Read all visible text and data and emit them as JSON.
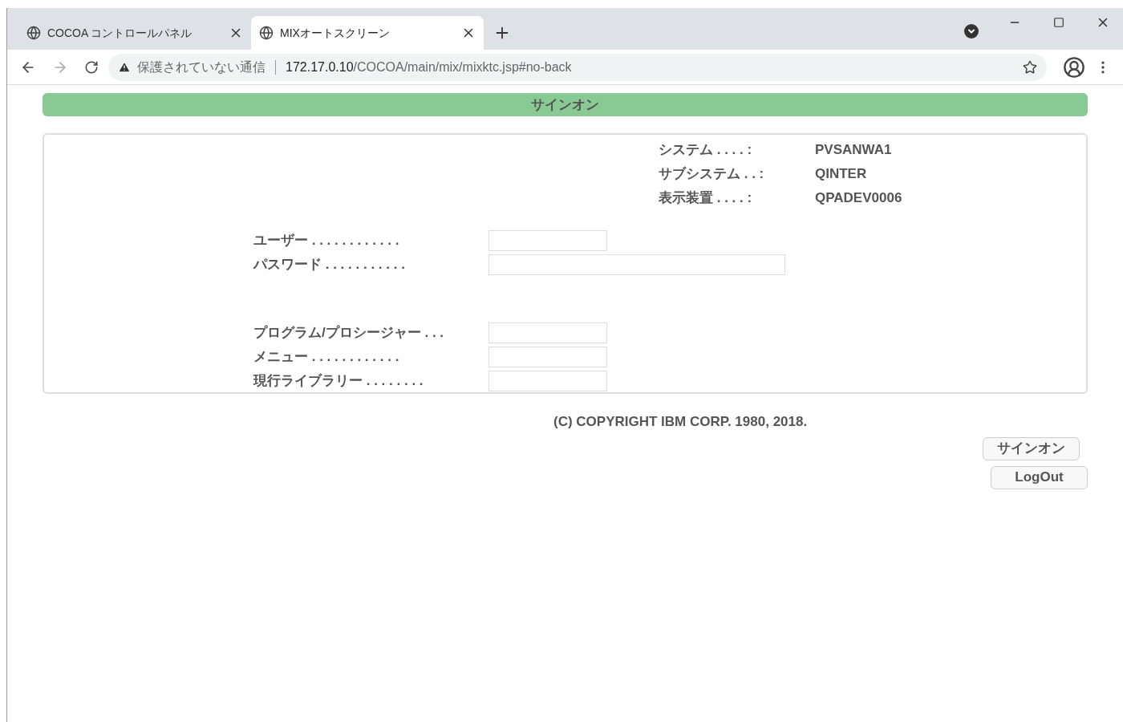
{
  "browser": {
    "tabs": [
      {
        "title": "COCOA コントロールパネル",
        "selected": false
      },
      {
        "title": "MIXオートスクリーン",
        "selected": true
      }
    ],
    "address_bar": {
      "security": "保護されていない通信",
      "host": "172.17.0.10",
      "path": "/COCOA/main/mix/mixktc.jsp#no-back"
    }
  },
  "page": {
    "title": "サインオン",
    "system_info": [
      {
        "label": "システム . . . . :",
        "value": "PVSANWA1"
      },
      {
        "label": "サブシステム . . :",
        "value": "QINTER"
      },
      {
        "label": "表示装置 . . . . :",
        "value": "QPADEV0006"
      }
    ],
    "login_fields": [
      {
        "label": "ユーザー . . . . . . . . . . . .",
        "kind": "short"
      },
      {
        "label": "パスワード . . . . . . . . . . .",
        "kind": "long"
      }
    ],
    "option_fields": [
      {
        "label": "プログラム/プロシージャー . . .",
        "kind": "short"
      },
      {
        "label": "メニュー . . . . . . . . . . . .",
        "kind": "short"
      },
      {
        "label": "現行ライブラリー . . . . . . . .",
        "kind": "short"
      }
    ],
    "copyright": "(C) COPYRIGHT IBM CORP. 1980, 2018.",
    "buttons": [
      "サインオン",
      "LogOut"
    ]
  }
}
